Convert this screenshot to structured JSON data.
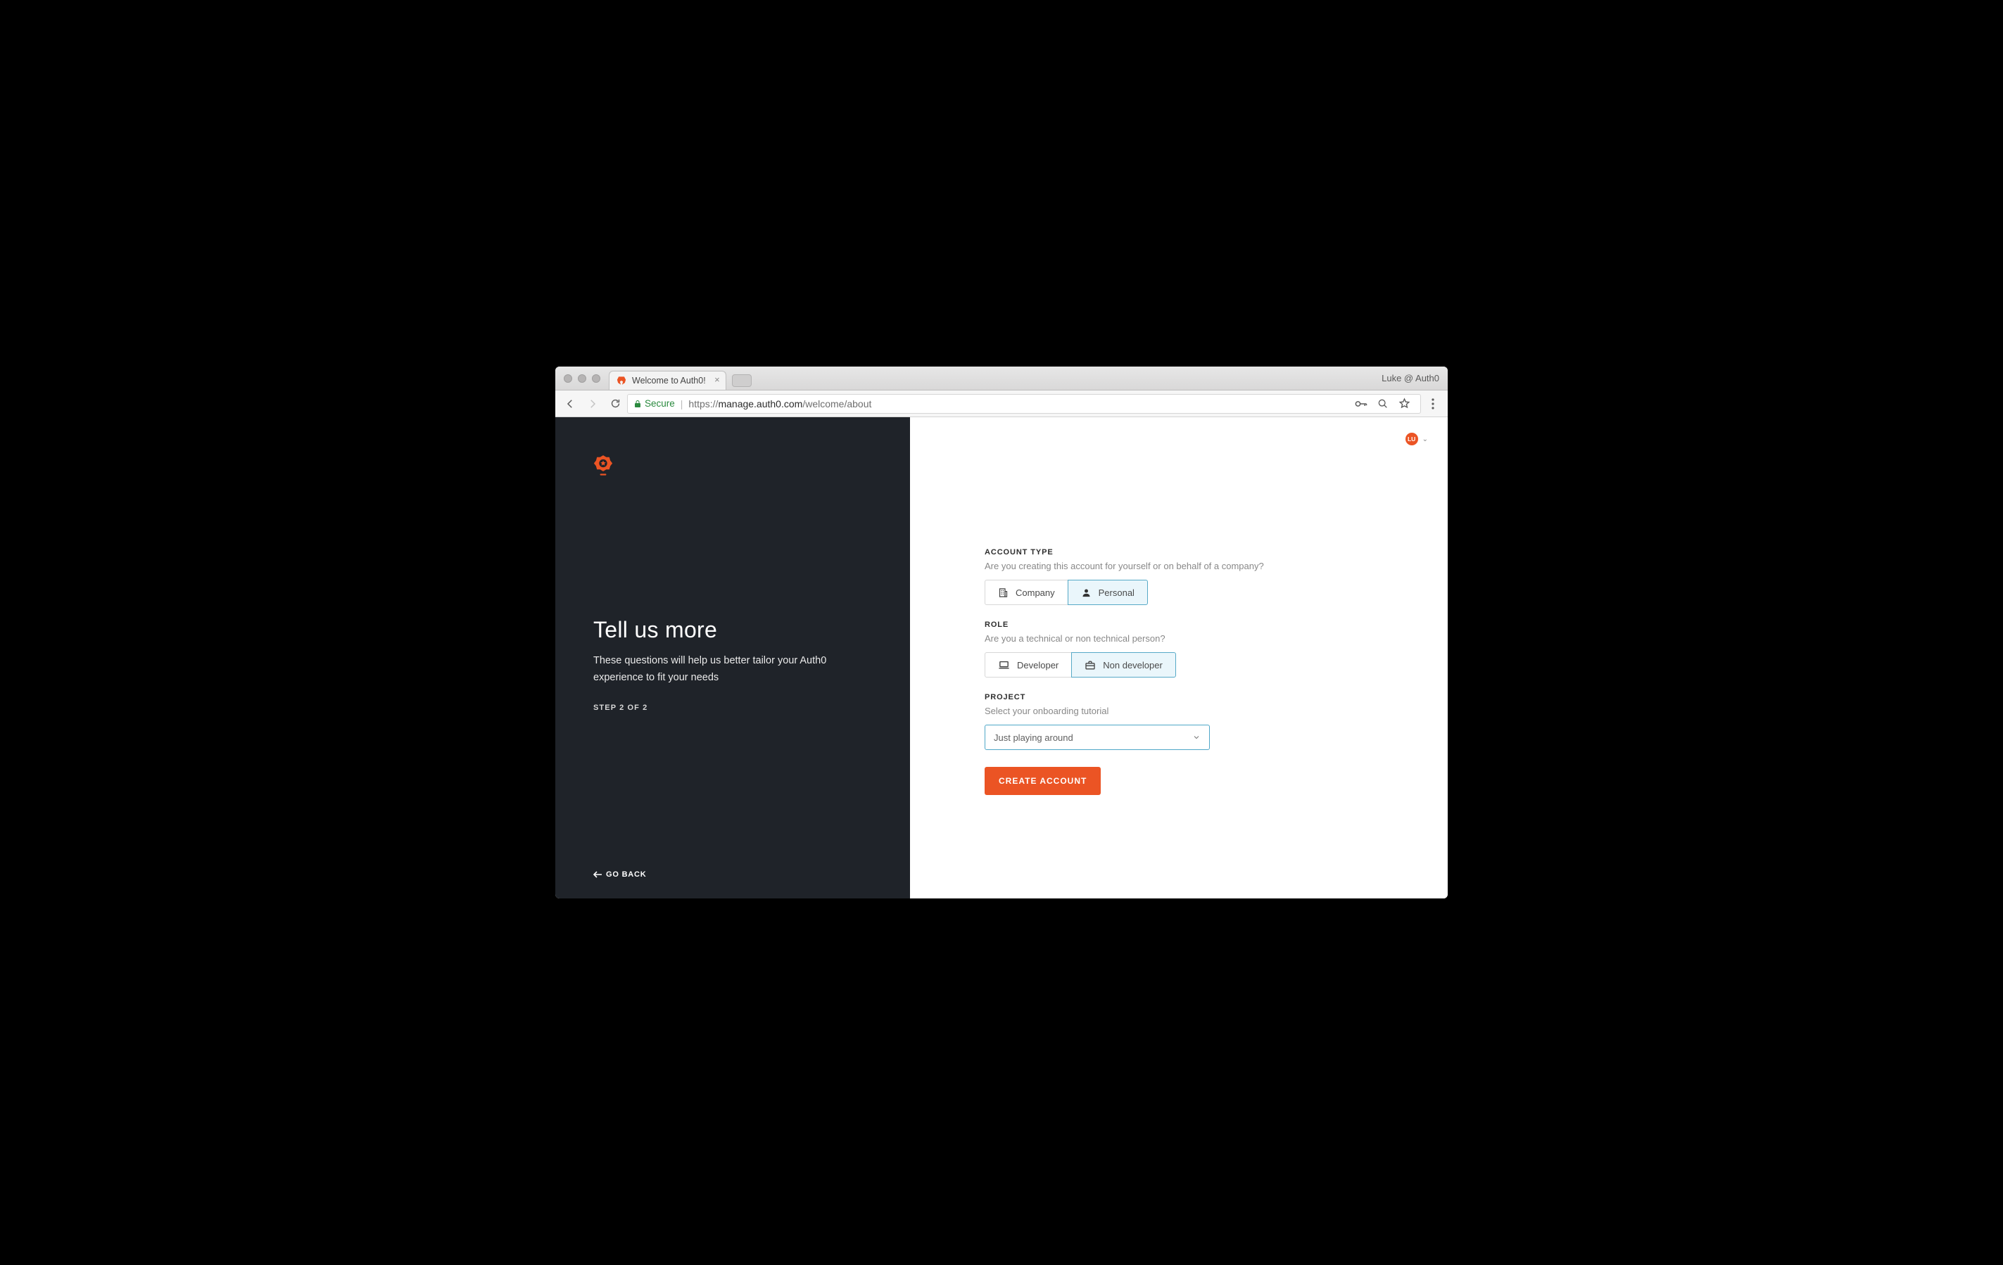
{
  "browser": {
    "profile_name": "Luke @ Auth0",
    "tab_title": "Welcome to Auth0!",
    "secure_label": "Secure",
    "url_scheme": "https://",
    "url_host": "manage.auth0.com",
    "url_path": "/welcome/about"
  },
  "left": {
    "heading": "Tell us more",
    "description": "These questions will help us better tailor your Auth0 experience to fit your needs",
    "step_label": "STEP 2 OF 2",
    "goback_label": "GO BACK"
  },
  "user": {
    "initials": "LU"
  },
  "form": {
    "account_type": {
      "label": "ACCOUNT TYPE",
      "sub": "Are you creating this account for yourself or on behalf of a company?",
      "options": [
        "Company",
        "Personal"
      ],
      "selected": "Personal"
    },
    "role": {
      "label": "ROLE",
      "sub": "Are you a technical or non technical person?",
      "options": [
        "Developer",
        "Non developer"
      ],
      "selected": "Non developer"
    },
    "project": {
      "label": "PROJECT",
      "sub": "Select your onboarding tutorial",
      "selected": "Just playing around"
    },
    "cta": "CREATE ACCOUNT"
  },
  "colors": {
    "accent": "#eb5424",
    "selected_bg": "#eaf6fb",
    "selected_border": "#56a9c7",
    "dark_panel": "#1f2329"
  }
}
